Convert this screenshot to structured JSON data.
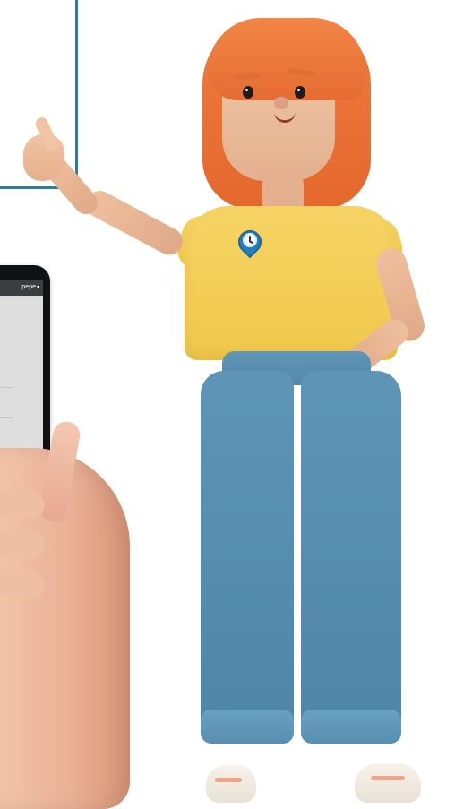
{
  "illustration": {
    "phone": {
      "screen": {
        "user_menu": {
          "label": "pepe",
          "icon": "caret-down-icon"
        }
      }
    },
    "character": {
      "shirt_logo": {
        "icon": "clock-pin-icon"
      }
    }
  }
}
